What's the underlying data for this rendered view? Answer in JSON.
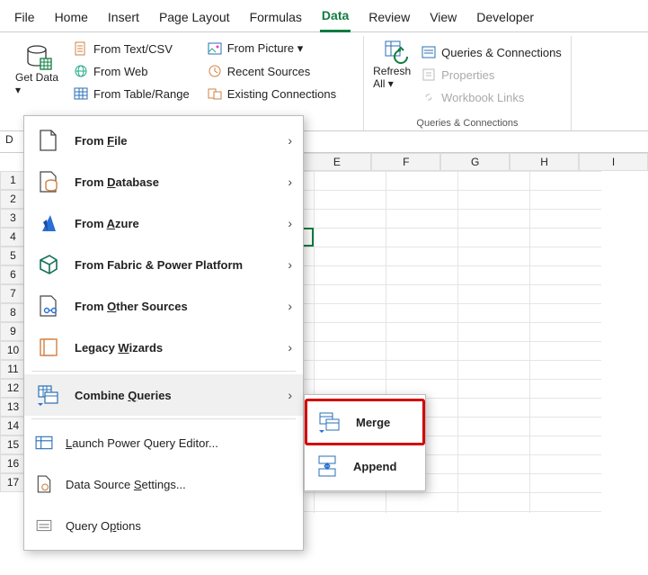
{
  "tabs": {
    "file": "File",
    "home": "Home",
    "insert": "Insert",
    "pagelayout": "Page Layout",
    "formulas": "Formulas",
    "data": "Data",
    "review": "Review",
    "view": "View",
    "developer": "Developer"
  },
  "ribbon": {
    "getdata": "Get Data",
    "textcsv": "From Text/CSV",
    "web": "From Web",
    "table": "From Table/Range",
    "picture": "From Picture",
    "recent": "Recent Sources",
    "existing": "Existing Connections",
    "refresh": "Refresh All",
    "qc": "Queries & Connections",
    "properties": "Properties",
    "wblinks": "Workbook Links",
    "qcgroup": "Queries & Connections"
  },
  "cols": {
    "e": "E",
    "f": "F",
    "g": "G",
    "h": "H",
    "i": "I"
  },
  "rows": {
    "r1": "1",
    "r2": "2",
    "r3": "3",
    "r4": "4",
    "r5": "5",
    "r6": "6",
    "r7": "7",
    "r8": "8",
    "r9": "9",
    "r10": "10",
    "r11": "11",
    "r12": "12",
    "r13": "13",
    "r14": "14",
    "r15": "15",
    "r16": "16",
    "r17": "17"
  },
  "namebox": "D",
  "menu": {
    "file": {
      "pre": "From ",
      "u": "F",
      "post": "ile"
    },
    "db": {
      "pre": "From ",
      "u": "D",
      "post": "atabase"
    },
    "azure": {
      "pre": "From ",
      "u": "A",
      "post": "zure"
    },
    "fabric": "From Fabric & Power Platform",
    "other": {
      "pre": "From ",
      "u": "O",
      "post": "ther Sources"
    },
    "legacy": {
      "pre": "Legacy ",
      "u": "W",
      "post": "izards"
    },
    "combine": {
      "pre": "Combine ",
      "u": "Q",
      "post": "ueries"
    },
    "launch": {
      "u": "L",
      "post": "aunch Power Query Editor..."
    },
    "settings": {
      "pre": "Data Source ",
      "u": "S",
      "post": "ettings..."
    },
    "options": {
      "pre": "Query O",
      "u": "p",
      "post": "tions"
    }
  },
  "submenu": {
    "merge": "Merge",
    "append": "Append"
  }
}
